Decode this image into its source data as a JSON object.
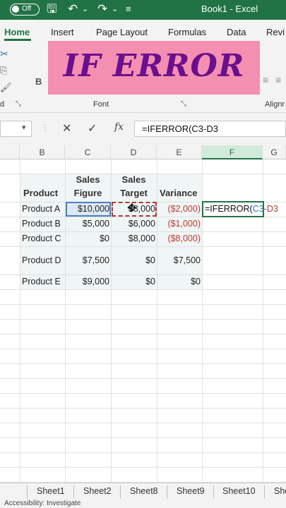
{
  "titlebar": {
    "autosave_state": "Off",
    "title": "Book1 - Excel"
  },
  "ribbon": {
    "tabs": [
      "Home",
      "Insert",
      "Page Layout",
      "Formulas",
      "Data",
      "Revi"
    ],
    "active_tab": "Home",
    "group_font_label": "Font",
    "group_align_label": "Alignr",
    "bold_label": "B"
  },
  "banner": {
    "text": "IF ERROR"
  },
  "formula_bar": {
    "cancel": "✕",
    "enter": "✓",
    "fx": "fx",
    "content": "=IFERROR(C3-D3"
  },
  "columns": [
    "B",
    "C",
    "D",
    "E",
    "F",
    "G"
  ],
  "table": {
    "headers": {
      "product": "Product",
      "sales_figure_1": "Sales",
      "sales_figure_2": "Figure",
      "sales_target_1": "Sales",
      "sales_target_2": "Target",
      "variance": "Variance"
    },
    "rows": [
      {
        "product": "Product A",
        "figure": "$10,000",
        "target": "$8,000",
        "variance": "($2,000)"
      },
      {
        "product": "Product B",
        "figure": "$5,000",
        "target": "$6,000",
        "variance": "($1,000)"
      },
      {
        "product": "Product C",
        "figure": "$0",
        "target": "$8,000",
        "variance": "($8,000)"
      },
      {
        "product": "Product D",
        "figure": "$7,500",
        "target": "$0",
        "variance": "$7,500"
      },
      {
        "product": "Product E",
        "figure": "$9,000",
        "target": "$0",
        "variance": "$0"
      }
    ]
  },
  "active_cell_formula": {
    "prefix": "=IFERROR(",
    "c_ref": "C3",
    "minus": "-",
    "d_ref": "D3"
  },
  "sheets": [
    "Sheet1",
    "Sheet2",
    "Sheet8",
    "Sheet9",
    "Sheet10",
    "She"
  ],
  "status": "Accessibility: Investigate",
  "colors": {
    "excel_green": "#217346",
    "banner_bg": "#f48fb1",
    "banner_text": "#6a0f8e",
    "negative": "#c0392b"
  }
}
